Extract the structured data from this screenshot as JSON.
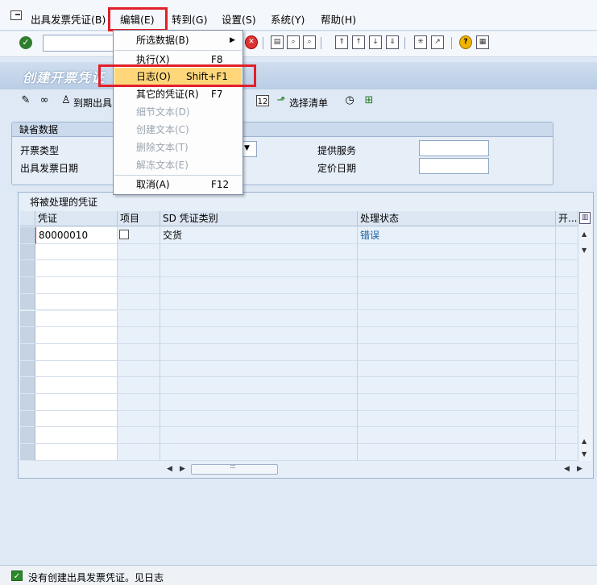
{
  "menubar": {
    "items": [
      "出具发票凭证(B)",
      "编辑(E)",
      "转到(G)",
      "设置(S)",
      "系统(Y)",
      "帮助(H)"
    ]
  },
  "toolbar": {
    "command_field_value": ""
  },
  "page": {
    "title": "创建开票凭证"
  },
  "app_toolbar": {
    "due_billing_label": "到期出具",
    "select_list_label": "选择清单"
  },
  "defaults": {
    "header": "缺省数据",
    "billing_type_label": "开票类型",
    "billing_date_label": "出具发票日期",
    "services_label": "提供服务",
    "pricing_date_label": "定价日期",
    "services_value": "",
    "pricing_date_value": ""
  },
  "table": {
    "title": "将被处理的凭证",
    "columns": [
      "凭证",
      "项目",
      "SD 凭证类别",
      "处理状态",
      "开..."
    ],
    "rows": [
      {
        "document": "80000010",
        "item": "",
        "category": "交货",
        "status": "错误"
      }
    ]
  },
  "dropdown": {
    "items": [
      {
        "label": "所选数据(B)",
        "shortcut": ""
      },
      {
        "label": "执行(X)",
        "shortcut": "F8"
      },
      {
        "label": "日志(O)",
        "shortcut": "Shift+F1"
      },
      {
        "label": "其它的凭证(R)",
        "shortcut": "F7"
      },
      {
        "label": "细节文本(D)",
        "shortcut": ""
      },
      {
        "label": "创建文本(C)",
        "shortcut": ""
      },
      {
        "label": "删除文本(T)",
        "shortcut": ""
      },
      {
        "label": "解冻文本(E)",
        "shortcut": ""
      },
      {
        "label": "取消(A)",
        "shortcut": "F12"
      }
    ]
  },
  "status": {
    "message": "没有创建出具发票凭证。见日志"
  },
  "colors": {
    "highlight_red": "#e0202a",
    "menu_highlight": "#ffd77a",
    "title_band": "#b9cde5"
  }
}
